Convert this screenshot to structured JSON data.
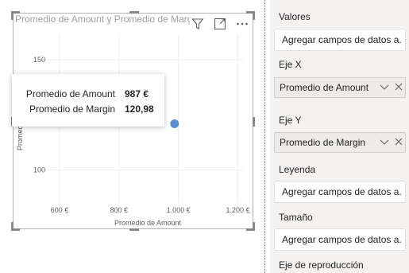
{
  "visual": {
    "title": "Promedio de Amount y Promedio de Margin",
    "header_icons": [
      "filter-icon",
      "focus-mode-icon",
      "more-options-icon"
    ]
  },
  "chart_data": {
    "type": "scatter",
    "title": "Promedio de Amount y Promedio de Margin",
    "xlabel": "Promedio de Amount",
    "ylabel": "Promedio de Margin",
    "xlim": [
      520,
      1220
    ],
    "ylim": [
      85,
      162
    ],
    "x_ticks": [
      600,
      800,
      1000,
      1200
    ],
    "x_tick_labels": [
      "600 €",
      "800 €",
      "1.000 €",
      "1.200 €"
    ],
    "y_ticks": [
      100,
      150
    ],
    "y_tick_labels": [
      "100",
      "150"
    ],
    "grid": true,
    "points": [
      {
        "x": 987,
        "y": 120.98
      }
    ],
    "point_color": "#5b8fd4"
  },
  "tooltip": {
    "rows": [
      {
        "label": "Promedio de Amount",
        "value": "987 €"
      },
      {
        "label": "Promedio de Margin",
        "value": "120,98"
      }
    ]
  },
  "fields_pane": {
    "wells": [
      {
        "label": "Valores",
        "placeholder": "Agregar campos de datos a..."
      },
      {
        "label": "Eje X",
        "field": "Promedio de Amount"
      },
      {
        "label": "Eje Y",
        "field": "Promedio de Margin"
      },
      {
        "label": "Leyenda",
        "placeholder": "Agregar campos de datos a..."
      },
      {
        "label": "Tamaño",
        "placeholder": "Agregar campos de datos a..."
      },
      {
        "label": "Eje de reproducción"
      }
    ]
  },
  "colors": {
    "pane_background": "#f3f2f1",
    "point": "#5b8fd4",
    "grid": "#eeeeee"
  }
}
